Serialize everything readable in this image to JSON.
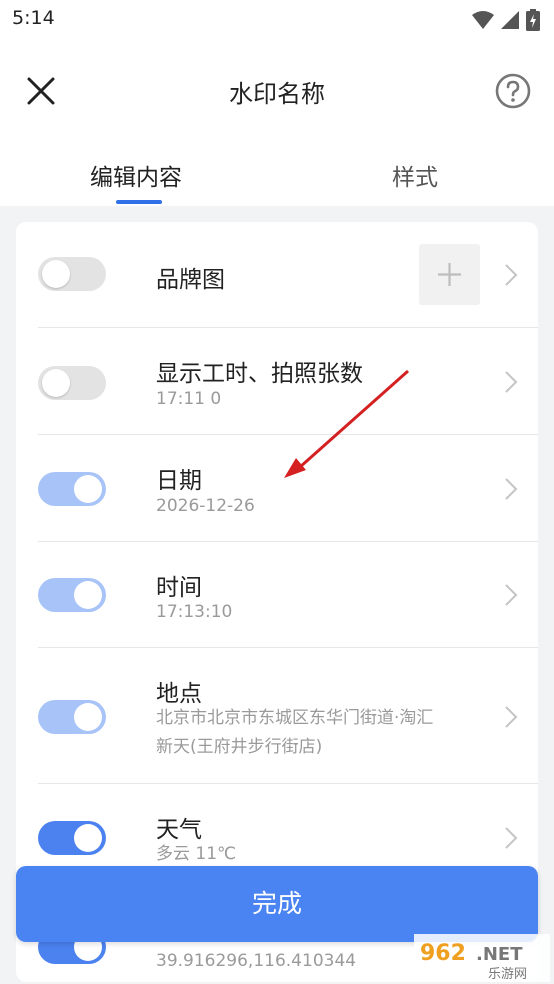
{
  "status_bar": {
    "time": "5:14"
  },
  "header": {
    "title": "水印名称"
  },
  "tabs": [
    {
      "label": "编辑内容",
      "active": true
    },
    {
      "label": "样式",
      "active": false
    }
  ],
  "items": [
    {
      "label": "品牌图",
      "sub": "",
      "toggle": "off"
    },
    {
      "label": "显示工时、拍照张数",
      "sub": "17:11  0",
      "toggle": "off"
    },
    {
      "label": "日期",
      "sub": "2026-12-26",
      "toggle": "on"
    },
    {
      "label": "时间",
      "sub": "17:13:10",
      "toggle": "on"
    },
    {
      "label": "地点",
      "sub_line1": "北京市北京市东城区东华门街道·淘汇",
      "sub_line2": "新天(王府井步行街店)",
      "toggle": "on"
    },
    {
      "label": "天气",
      "sub": "多云 11℃",
      "toggle": "on"
    },
    {
      "label": "",
      "sub": "39.916296,116.410344",
      "toggle": "on"
    }
  ],
  "done_button": {
    "label": "完成"
  },
  "watermark": {
    "text": "962.NET",
    "subtext": "乐游网"
  },
  "colors": {
    "accent": "#4a84f2",
    "toggle_on_light": "#a7c3f7",
    "annotation_arrow": "#d42020"
  }
}
